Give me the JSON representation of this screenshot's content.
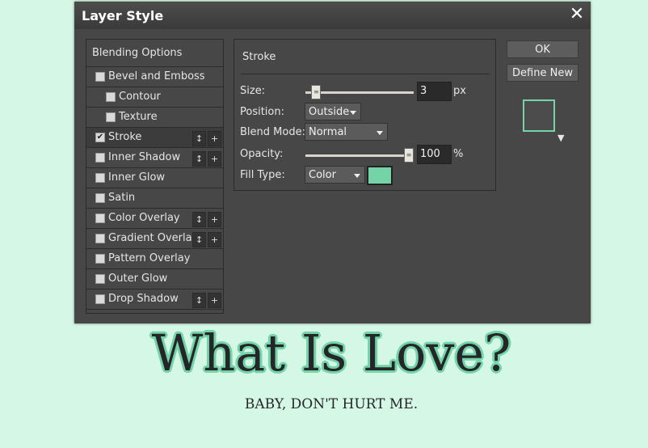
{
  "dialog": {
    "title": "Layer Style",
    "close_glyph": "✕"
  },
  "styles_list": {
    "blending_options": "Blending Options",
    "items": [
      {
        "label": "Bevel and Emboss",
        "checked": false,
        "indent": false,
        "controls": false
      },
      {
        "label": "Contour",
        "checked": false,
        "indent": true,
        "controls": false
      },
      {
        "label": "Texture",
        "checked": false,
        "indent": true,
        "controls": false
      },
      {
        "label": "Stroke",
        "checked": true,
        "indent": false,
        "controls": true,
        "active": true
      },
      {
        "label": "Inner Shadow",
        "checked": false,
        "indent": false,
        "controls": true
      },
      {
        "label": "Inner Glow",
        "checked": false,
        "indent": false,
        "controls": false
      },
      {
        "label": "Satin",
        "checked": false,
        "indent": false,
        "controls": false
      },
      {
        "label": "Color Overlay",
        "checked": false,
        "indent": false,
        "controls": true
      },
      {
        "label": "Gradient Overlay",
        "checked": false,
        "indent": false,
        "controls": true
      },
      {
        "label": "Pattern Overlay",
        "checked": false,
        "indent": false,
        "controls": false
      },
      {
        "label": "Outer Glow",
        "checked": false,
        "indent": false,
        "controls": false
      },
      {
        "label": "Drop Shadow",
        "checked": false,
        "indent": false,
        "controls": true
      }
    ],
    "move_glyph": "↕",
    "add_glyph": "+",
    "check_glyph": "✔"
  },
  "stroke_panel": {
    "title": "Stroke",
    "size_label": "Size:",
    "size_value": "3",
    "size_unit": "px",
    "size_slider_fraction": 0.06,
    "position_label": "Position:",
    "position_value": "Outside",
    "blend_mode_label": "Blend Mode:",
    "blend_mode_value": "Normal",
    "opacity_label": "Opacity:",
    "opacity_value": "100",
    "opacity_unit": "%",
    "opacity_slider_fraction": 1.0,
    "fill_type_label": "Fill Type:",
    "fill_type_value": "Color",
    "stroke_color": "#74d4a8"
  },
  "buttons": {
    "ok": "OK",
    "define_new": "Define New"
  },
  "preview": {
    "arrow_glyph": "▼",
    "border_color": "#74d4a8"
  },
  "background": {
    "headline": "What Is Love?",
    "subline": "BABY, DON'T HURT ME."
  }
}
